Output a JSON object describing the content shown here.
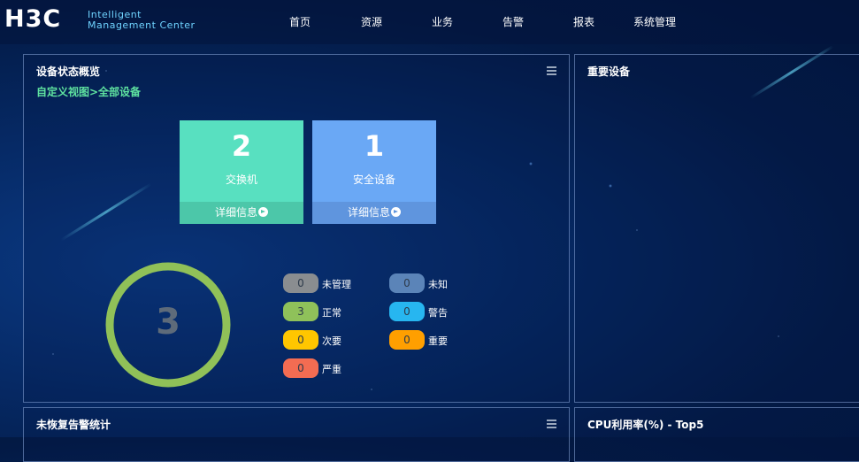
{
  "header": {
    "logo": "H3C",
    "logo_sub_line1": "Intelligent",
    "logo_sub_line2": "Management Center",
    "nav": [
      "首页",
      "资源",
      "业务",
      "告警",
      "报表",
      "系统管理"
    ]
  },
  "device_panel": {
    "title": "设备状态概览",
    "breadcrumb": "自定义视图>全部设备",
    "cards": [
      {
        "count": "2",
        "name": "交换机",
        "detail": "详细信息",
        "color": "#58e0c0",
        "foot_color": "#4cc7a9"
      },
      {
        "count": "1",
        "name": "安全设备",
        "detail": "详细信息",
        "color": "#6aa8f5",
        "foot_color": "#5f95de"
      }
    ],
    "total": "3",
    "ring_color": "#90c158",
    "legend": [
      {
        "label": "未管理",
        "count": "0",
        "color": "#8a8d90"
      },
      {
        "label": "未知",
        "count": "0",
        "color": "#5b84b8"
      },
      {
        "label": "正常",
        "count": "3",
        "color": "#8fc15a"
      },
      {
        "label": "警告",
        "count": "0",
        "color": "#27b6f0"
      },
      {
        "label": "次要",
        "count": "0",
        "color": "#ffc600"
      },
      {
        "label": "重要",
        "count": "0",
        "color": "#ff9f00"
      },
      {
        "label": "严重",
        "count": "0",
        "color": "#f36c52"
      }
    ]
  },
  "important_panel": {
    "title": "重要设备"
  },
  "alarm_panel": {
    "title": "未恢复告警统计"
  },
  "cpu_panel": {
    "title": "CPU利用率(%) - Top5"
  }
}
